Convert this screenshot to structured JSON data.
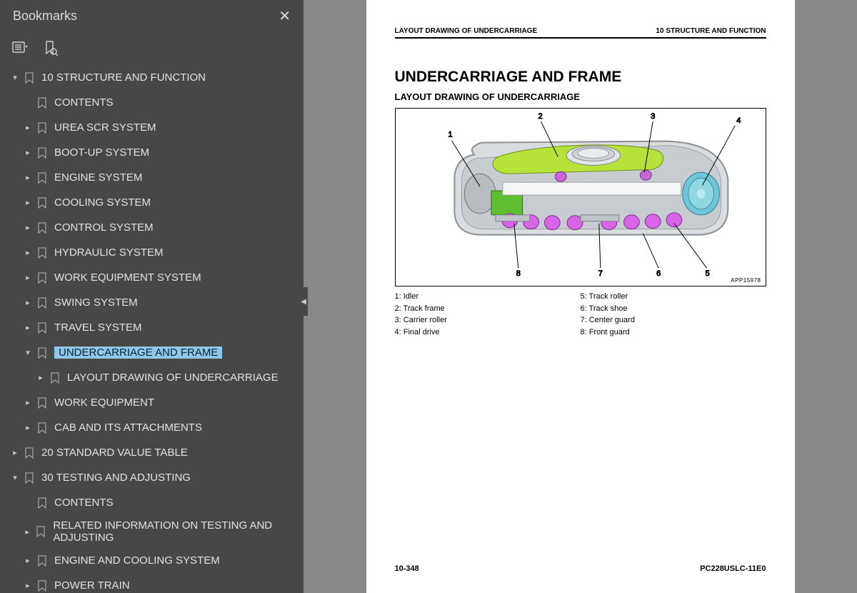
{
  "sidebar": {
    "title": "Bookmarks",
    "tree": [
      {
        "lvl": 0,
        "caret": "down",
        "label": "10 STRUCTURE AND FUNCTION"
      },
      {
        "lvl": 1,
        "caret": "none",
        "label": "CONTENTS"
      },
      {
        "lvl": 1,
        "caret": "right",
        "label": "UREA SCR SYSTEM"
      },
      {
        "lvl": 1,
        "caret": "right",
        "label": "BOOT-UP SYSTEM"
      },
      {
        "lvl": 1,
        "caret": "right",
        "label": "ENGINE SYSTEM"
      },
      {
        "lvl": 1,
        "caret": "right",
        "label": "COOLING SYSTEM"
      },
      {
        "lvl": 1,
        "caret": "right",
        "label": "CONTROL SYSTEM"
      },
      {
        "lvl": 1,
        "caret": "right",
        "label": "HYDRAULIC SYSTEM"
      },
      {
        "lvl": 1,
        "caret": "right",
        "label": "WORK EQUIPMENT SYSTEM"
      },
      {
        "lvl": 1,
        "caret": "right",
        "label": "SWING SYSTEM"
      },
      {
        "lvl": 1,
        "caret": "right",
        "label": "TRAVEL SYSTEM"
      },
      {
        "lvl": 1,
        "caret": "down",
        "label": "UNDERCARRIAGE AND FRAME",
        "selected": true
      },
      {
        "lvl": 2,
        "caret": "right",
        "label": "LAYOUT DRAWING OF UNDERCARRIAGE"
      },
      {
        "lvl": 1,
        "caret": "right",
        "label": "WORK EQUIPMENT"
      },
      {
        "lvl": 1,
        "caret": "right",
        "label": "CAB AND ITS ATTACHMENTS"
      },
      {
        "lvl": 0,
        "caret": "right",
        "label": "20 STANDARD VALUE TABLE"
      },
      {
        "lvl": 0,
        "caret": "down",
        "label": "30 TESTING AND ADJUSTING"
      },
      {
        "lvl": 1,
        "caret": "none",
        "label": "CONTENTS"
      },
      {
        "lvl": 1,
        "caret": "right",
        "label": "RELATED INFORMATION ON TESTING AND ADJUSTING",
        "multi": true
      },
      {
        "lvl": 1,
        "caret": "right",
        "label": "ENGINE AND COOLING SYSTEM"
      },
      {
        "lvl": 1,
        "caret": "right",
        "label": "POWER TRAIN"
      }
    ]
  },
  "page": {
    "header_left": "LAYOUT DRAWING OF UNDERCARRIAGE",
    "header_right": "10 STRUCTURE AND FUNCTION",
    "h1": "UNDERCARRIAGE AND FRAME",
    "h2": "LAYOUT DRAWING OF UNDERCARRIAGE",
    "figure_code": "APP15978",
    "callouts": [
      "1",
      "2",
      "3",
      "4",
      "5",
      "6",
      "7",
      "8"
    ],
    "legend_left": [
      {
        "n": "1",
        "t": "Idler"
      },
      {
        "n": "2",
        "t": "Track frame"
      },
      {
        "n": "3",
        "t": "Carrier roller"
      },
      {
        "n": "4",
        "t": "Final drive"
      }
    ],
    "legend_right": [
      {
        "n": "5",
        "t": "Track roller"
      },
      {
        "n": "6",
        "t": "Track shoe"
      },
      {
        "n": "7",
        "t": "Center guard"
      },
      {
        "n": "8",
        "t": "Front guard"
      }
    ],
    "footer_left": "10-348",
    "footer_right": "PC228USLC-11E0"
  }
}
